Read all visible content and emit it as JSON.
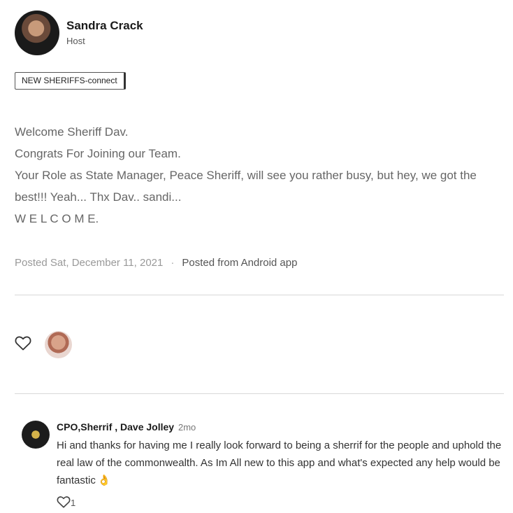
{
  "post": {
    "author_name": "Sandra Crack",
    "author_role": "Host",
    "tag": "NEW SHERIFFS-connect",
    "body_lines": [
      "Welcome Sheriff Dav.",
      "Congrats For Joining our Team.",
      "Your Role as State Manager, Peace Sheriff, will see you rather busy, but hey, we got the best!!! Yeah... Thx Dav.. sandi...",
      "W E L C O M E."
    ],
    "posted_date": "Posted Sat, December 11, 2021",
    "separator": "·",
    "posted_source": "Posted from Android app"
  },
  "reactions": {
    "heart_icon": "heart-outline-icon"
  },
  "comment": {
    "author": "CPO,Sherrif , Dave Jolley",
    "time": "2mo",
    "text": "Hi and thanks for having me I really look forward to being a sherrif for the people and uphold the real law of the commonwealth. As Im All new to this app and what's expected any help would be fantastic",
    "emoji": "👌",
    "like_count": "1"
  },
  "colors": {
    "text_muted": "#666666",
    "divider": "#d8d8d8"
  }
}
